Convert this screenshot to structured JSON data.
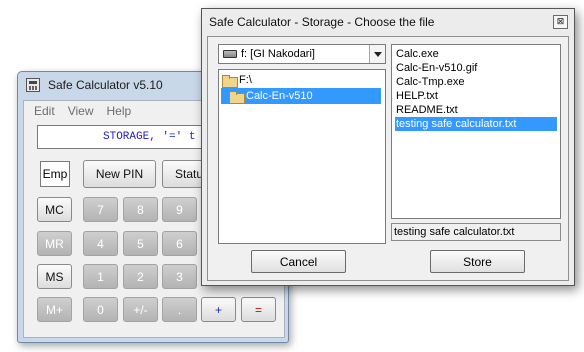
{
  "calculator": {
    "title": "Safe Calculator v5.10",
    "menu": [
      "Edit",
      "View",
      "Help"
    ],
    "display": "STORAGE, '=' t",
    "emp_label": "Emp",
    "new_pin_label": "New PIN",
    "status_label": "Status",
    "memory_buttons": [
      "MC",
      "MR",
      "MS",
      "M+"
    ],
    "digit_rows": [
      [
        "7",
        "8",
        "9"
      ],
      [
        "4",
        "5",
        "6"
      ],
      [
        "1",
        "2",
        "3"
      ],
      [
        "0",
        "+/-",
        "."
      ]
    ],
    "plus_label": "+",
    "equals_label": "="
  },
  "dialog": {
    "title": "Safe Calculator - Storage - Choose the file",
    "close_label": "⊠",
    "drive": "f: [GI Nakodari]",
    "directories": [
      "F:\\",
      "Calc-En-v510"
    ],
    "selected_directory": 1,
    "files": [
      "Calc.exe",
      "Calc-En-v510.gif",
      "Calc-Tmp.exe",
      "HELP.txt",
      "README.txt",
      "testing safe calculator.txt"
    ],
    "selected_file": 5,
    "file_name_value": "testing safe calculator.txt",
    "cancel_label": "Cancel",
    "store_label": "Store"
  }
}
